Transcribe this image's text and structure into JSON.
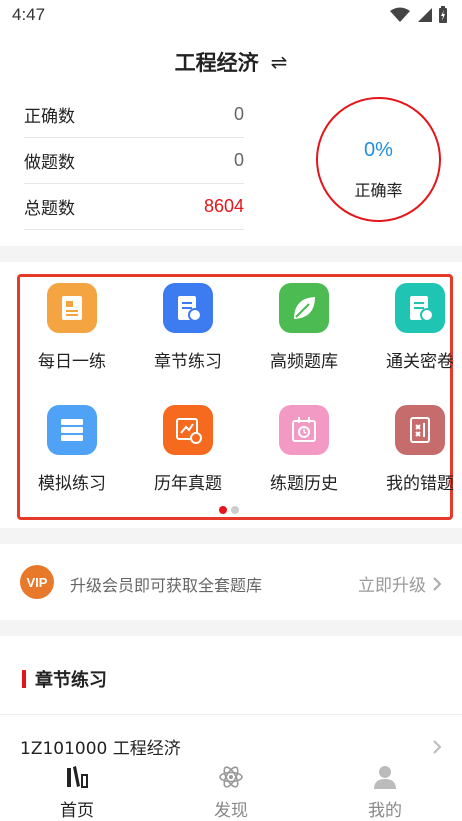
{
  "status_bar": {
    "time": "4:47"
  },
  "header": {
    "title": "工程经济",
    "swap_symbol": "⇌"
  },
  "stats": {
    "correct_label": "正确数",
    "correct_value": "0",
    "done_label": "做题数",
    "done_value": "0",
    "total_label": "总题数",
    "total_value": "8604",
    "rate_value": "0%",
    "rate_label": "正确率"
  },
  "menu": {
    "items": [
      {
        "label": "每日一练",
        "icon": "daily-practice-icon",
        "color": "#f5a442"
      },
      {
        "label": "章节练习",
        "icon": "chapter-practice-icon",
        "color": "#3d7bf0"
      },
      {
        "label": "高频题库",
        "icon": "leaf-icon",
        "color": "#4cbb52"
      },
      {
        "label": "通关密卷",
        "icon": "secret-paper-icon",
        "color": "#20c4b3"
      },
      {
        "label": "模拟练习",
        "icon": "mock-exam-icon",
        "color": "#4fa2f5"
      },
      {
        "label": "历年真题",
        "icon": "past-papers-icon",
        "color": "#f56a1e"
      },
      {
        "label": "练题历史",
        "icon": "history-calendar-icon",
        "color": "#f29ac4"
      },
      {
        "label": "我的错题",
        "icon": "wrong-notebook-icon",
        "color": "#c76c6c"
      }
    ]
  },
  "vip": {
    "logo": "VIP",
    "text": "升级会员即可获取全套题库",
    "action": "立即升级"
  },
  "chapters": {
    "title": "章节练习",
    "items": [
      {
        "label": "1Z101000  工程经济"
      }
    ]
  },
  "tabs": [
    {
      "label": "首页",
      "icon": "books-icon",
      "active": true
    },
    {
      "label": "发现",
      "icon": "atom-icon",
      "active": false
    },
    {
      "label": "我的",
      "icon": "user-icon",
      "active": false
    }
  ],
  "colors": {
    "accent": "#e5161b",
    "rate_blue": "#1e8fe0",
    "frame": "#e53a2a"
  }
}
